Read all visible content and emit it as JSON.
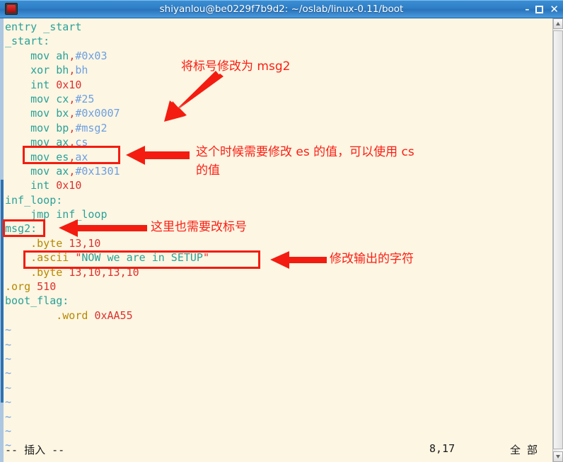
{
  "window": {
    "title": "shiyanlou@be0229f7b9d2: ~/oslab/linux-0.11/boot",
    "icon": "terminal-icon",
    "buttons": {
      "minimize": "–",
      "maximize": "",
      "close": "✕"
    }
  },
  "editor": {
    "lines": [
      [
        {
          "t": "entry _start",
          "c": "c-key"
        }
      ],
      [
        {
          "t": "_start:",
          "c": "c-key"
        }
      ],
      [
        {
          "t": "    mov ",
          "c": "c-key"
        },
        {
          "t": "ah",
          "c": "c-key"
        },
        {
          "t": ",",
          "c": "c-punct"
        },
        {
          "t": "#0x03",
          "c": "c-reg"
        }
      ],
      [
        {
          "t": "    xor ",
          "c": "c-key"
        },
        {
          "t": "bh",
          "c": "c-key"
        },
        {
          "t": ",",
          "c": "c-punct"
        },
        {
          "t": "bh",
          "c": "c-reg"
        }
      ],
      [
        {
          "t": "    int ",
          "c": "c-key"
        },
        {
          "t": "0x10",
          "c": "c-num"
        }
      ],
      [
        {
          "t": "    mov ",
          "c": "c-key"
        },
        {
          "t": "cx",
          "c": "c-key"
        },
        {
          "t": ",",
          "c": "c-punct"
        },
        {
          "t": "#25",
          "c": "c-reg"
        }
      ],
      [
        {
          "t": "    mov ",
          "c": "c-key"
        },
        {
          "t": "bx",
          "c": "c-key"
        },
        {
          "t": ",",
          "c": "c-punct"
        },
        {
          "t": "#0x0007",
          "c": "c-reg"
        }
      ],
      [
        {
          "t": "    mov ",
          "c": "c-key"
        },
        {
          "t": "bp",
          "c": "c-key"
        },
        {
          "t": ",",
          "c": "c-punct"
        },
        {
          "t": "#msg2",
          "c": "c-reg"
        }
      ],
      [
        {
          "t": "    mov ",
          "c": "c-key"
        },
        {
          "t": "ax",
          "c": "c-key"
        },
        {
          "t": ",",
          "c": "c-punct"
        },
        {
          "t": "cs",
          "c": "c-reg"
        }
      ],
      [
        {
          "t": "    mov ",
          "c": "c-key"
        },
        {
          "t": "es",
          "c": "c-key"
        },
        {
          "t": ",",
          "c": "c-punct"
        },
        {
          "t": "ax",
          "c": "c-reg"
        }
      ],
      [
        {
          "t": "    mov ",
          "c": "c-key"
        },
        {
          "t": "ax",
          "c": "c-key"
        },
        {
          "t": ",",
          "c": "c-punct"
        },
        {
          "t": "#0x1301",
          "c": "c-reg"
        }
      ],
      [
        {
          "t": "    int ",
          "c": "c-key"
        },
        {
          "t": "0x10",
          "c": "c-num"
        }
      ],
      [
        {
          "t": "inf_loop:",
          "c": "c-key"
        }
      ],
      [
        {
          "t": "    jmp inf_loop",
          "c": "c-key"
        }
      ],
      [
        {
          "t": "msg2:",
          "c": "c-key"
        }
      ],
      [
        {
          "t": "    .byte ",
          "c": "c-dir"
        },
        {
          "t": "13",
          "c": "c-num"
        },
        {
          "t": ",",
          "c": "c-punct"
        },
        {
          "t": "10",
          "c": "c-num"
        }
      ],
      [
        {
          "t": "    .ascii ",
          "c": "c-dir"
        },
        {
          "t": "\"",
          "c": "c-num"
        },
        {
          "t": "NOW we are in SETUP",
          "c": "c-str"
        },
        {
          "t": "\"",
          "c": "c-num"
        }
      ],
      [
        {
          "t": "    .byte ",
          "c": "c-dir"
        },
        {
          "t": "13",
          "c": "c-num"
        },
        {
          "t": ",",
          "c": "c-punct"
        },
        {
          "t": "10",
          "c": "c-num"
        },
        {
          "t": ",",
          "c": "c-punct"
        },
        {
          "t": "13",
          "c": "c-num"
        },
        {
          "t": ",",
          "c": "c-punct"
        },
        {
          "t": "10",
          "c": "c-num"
        }
      ],
      [
        {
          "t": ".org ",
          "c": "c-dir"
        },
        {
          "t": "510",
          "c": "c-num"
        }
      ],
      [
        {
          "t": "boot_flag:",
          "c": "c-key"
        }
      ],
      [
        {
          "t": "        .word ",
          "c": "c-dir"
        },
        {
          "t": "0xAA55",
          "c": "c-num"
        }
      ],
      [
        {
          "t": "~",
          "c": "c-tilde"
        }
      ],
      [
        {
          "t": "~",
          "c": "c-tilde"
        }
      ],
      [
        {
          "t": "~",
          "c": "c-tilde"
        }
      ],
      [
        {
          "t": "~",
          "c": "c-tilde"
        }
      ],
      [
        {
          "t": "~",
          "c": "c-tilde"
        }
      ],
      [
        {
          "t": "~",
          "c": "c-tilde"
        }
      ],
      [
        {
          "t": "~",
          "c": "c-tilde"
        }
      ],
      [
        {
          "t": "~",
          "c": "c-tilde"
        }
      ],
      [
        {
          "t": "~",
          "c": "c-tilde"
        }
      ]
    ]
  },
  "statusbar": {
    "mode": "-- 插入 --",
    "position": "8,17",
    "scroll": "全 部"
  },
  "scrollbar": {
    "up_arrow": "scroll-up-arrow",
    "down_arrow": "scroll-down-arrow"
  },
  "annotations": {
    "note1": "将标号修改为 msg2",
    "note2_line1": "这个时候需要修改 es 的值，可以使用 cs",
    "note2_line2": "的值",
    "note3": "这里也需要改标号",
    "note4": "修改输出的字符",
    "color": "#fa1e14"
  }
}
